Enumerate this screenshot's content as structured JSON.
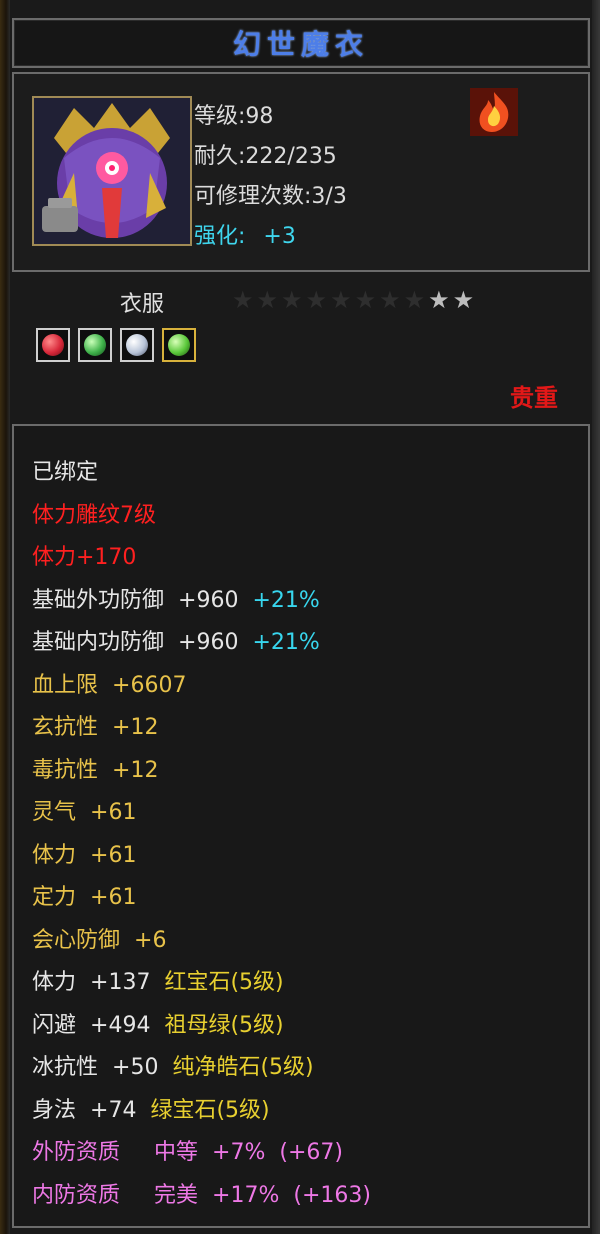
{
  "item": {
    "name": "幻世魔衣",
    "level_text": "等级:98",
    "durability_text": "耐久:222/235",
    "repair_text": "可修理次数:3/3",
    "refine_label": "强化:",
    "refine_value": "+3",
    "portrait_icon": "demon-armor-portrait-icon",
    "element_icon": "fire-element-icon"
  },
  "equip": {
    "slot": "衣服",
    "stars": {
      "lit": 2,
      "total": 10
    },
    "gems": [
      {
        "icon": "red-ruby-gem-icon",
        "color": "#d8283a"
      },
      {
        "icon": "green-emerald-gem-icon",
        "color": "#3fb24a"
      },
      {
        "icon": "white-diamond-gem-icon",
        "color": "#b8c4d8"
      },
      {
        "icon": "green-jade-gem-icon",
        "color": "#5ac83a"
      }
    ],
    "rarity": "贵重"
  },
  "attributes": [
    {
      "color": "white",
      "parts": [
        "已绑定"
      ]
    },
    {
      "color": "red",
      "parts": [
        "体力雕纹7级"
      ]
    },
    {
      "color": "red",
      "parts": [
        "体力+170"
      ]
    },
    {
      "color": "white",
      "parts": [
        "基础外功防御",
        "+960"
      ],
      "extra": "+21%"
    },
    {
      "color": "white",
      "parts": [
        "基础内功防御",
        "+960"
      ],
      "extra": "+21%"
    },
    {
      "color": "gold",
      "parts": [
        "血上限",
        "+6607"
      ]
    },
    {
      "color": "gold",
      "parts": [
        "玄抗性",
        "+12"
      ]
    },
    {
      "color": "gold",
      "parts": [
        "毒抗性",
        "+12"
      ]
    },
    {
      "color": "gold",
      "parts": [
        "灵气",
        "+61"
      ]
    },
    {
      "color": "gold",
      "parts": [
        "体力",
        "+61"
      ]
    },
    {
      "color": "gold",
      "parts": [
        "定力",
        "+61"
      ]
    },
    {
      "color": "gold",
      "parts": [
        "会心防御",
        "+6"
      ]
    },
    {
      "color": "white",
      "parts": [
        "体力",
        "+137"
      ],
      "gem": "红宝石(5级)"
    },
    {
      "color": "white",
      "parts": [
        "闪避",
        "+494"
      ],
      "gem": "祖母绿(5级)"
    },
    {
      "color": "white",
      "parts": [
        "冰抗性",
        "+50"
      ],
      "gem": "纯净皓石(5级)"
    },
    {
      "color": "white",
      "parts": [
        "身法",
        "+74"
      ],
      "gem": "绿宝石(5级)"
    },
    {
      "color": "pink",
      "parts": [
        "外防资质",
        "中等",
        "+7%",
        "(+67)"
      ]
    },
    {
      "color": "pink",
      "parts": [
        "内防资质",
        "完美",
        "+17%",
        "(+163)"
      ]
    }
  ]
}
